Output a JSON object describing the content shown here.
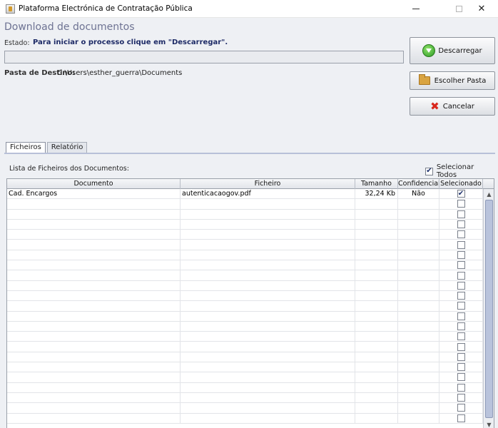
{
  "window": {
    "title": "Plataforma Electrónica de Contratação Pública"
  },
  "page": {
    "heading": "Download de documentos",
    "estado_label": "Estado:",
    "estado_message": "Para iniciar o processo clique em \"Descarregar\".",
    "dest_label": "Pasta de Destino:",
    "dest_value": "C:\\Users\\esther_guerra\\Documents",
    "progress_fraction": 0
  },
  "buttons": {
    "download": "Descarregar",
    "choose_folder": "Escolher Pasta",
    "cancel": "Cancelar"
  },
  "tabs": [
    {
      "label": "Ficheiros",
      "active": true
    },
    {
      "label": "Relatório",
      "active": false
    }
  ],
  "files_panel": {
    "list_label": "Lista de Ficheiros dos Documentos:",
    "select_all_label": "Selecionar Todos",
    "select_all_checked": true,
    "columns": [
      "Documento",
      "Ficheiro",
      "Tamanho",
      "Confidencial",
      "Selecionado"
    ],
    "rows": [
      {
        "documento": "Cad. Encargos",
        "ficheiro": "autenticacaogov.pdf",
        "tamanho": "32,24 Kb",
        "confidencial": "Não",
        "selecionado": true
      }
    ],
    "empty_rows": 22
  },
  "icons": {
    "download": "download-arrow-icon",
    "folder": "folder-icon",
    "cancel": "red-x-icon"
  },
  "colors": {
    "heading": "#6e7393",
    "status_message": "#1d2a66",
    "panel_bg": "#eef0f4",
    "scroll_thumb": "#b9c3dc"
  }
}
